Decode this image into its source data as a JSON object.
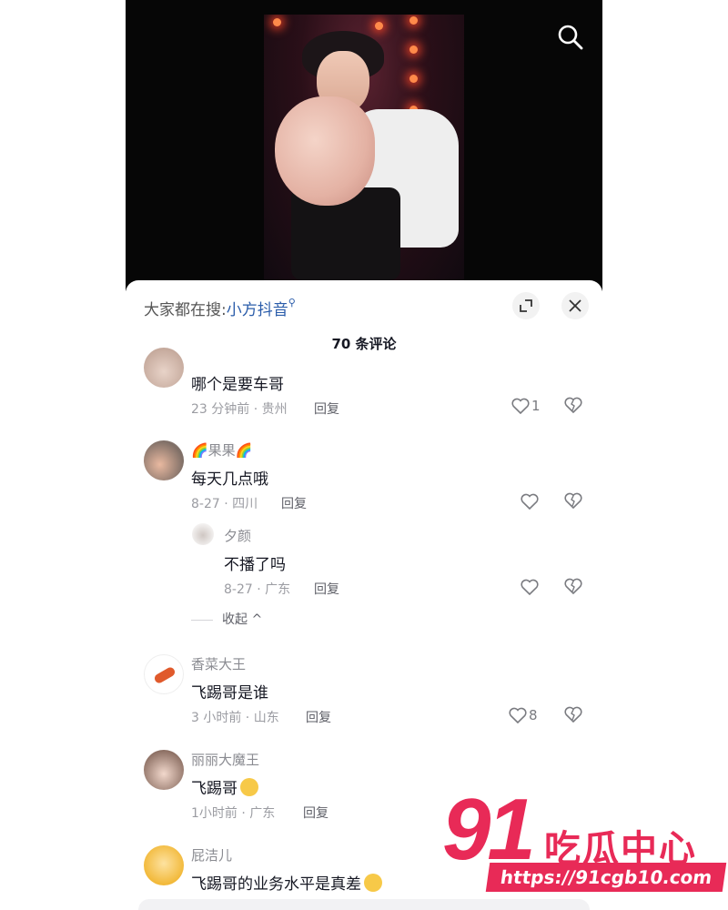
{
  "video": {
    "search_icon": "search-icon"
  },
  "sheet": {
    "search_hint_prefix": "大家都在搜:",
    "search_hint_term": "小方抖音",
    "expand_icon": "expand-icon",
    "close_icon": "close-icon",
    "comment_count_title": "70 条评论"
  },
  "comments": [
    {
      "text": "哪个是要车哥",
      "meta": "23 分钟前 · 贵州",
      "reply_label": "回复",
      "likes": "1"
    },
    {
      "username": "🌈果果🌈",
      "text": "每天几点哦",
      "meta": "8-27 · 四川",
      "reply_label": "回复",
      "replies": [
        {
          "username": "夕颜",
          "text": "不播了吗",
          "meta": "8-27 · 广东",
          "reply_label": "回复"
        }
      ],
      "collapse_label": "收起 ^"
    },
    {
      "username": "香菜大王",
      "text": "飞踢哥是谁",
      "meta": "3 小时前 · 山东",
      "reply_label": "回复",
      "likes": "8"
    },
    {
      "username": "丽丽大魔王",
      "text": "飞踢哥",
      "meta": "1小时前 · 广东",
      "reply_label": "回复"
    },
    {
      "username": "屁洁儿",
      "text": "飞踢哥的业务水平是真差"
    }
  ],
  "watermark": {
    "number": "91",
    "name": "吃瓜中心",
    "url": "https://91cgb10.com"
  },
  "colors": {
    "link_blue": "#2a5caa",
    "watermark_red": "#e82a57"
  }
}
